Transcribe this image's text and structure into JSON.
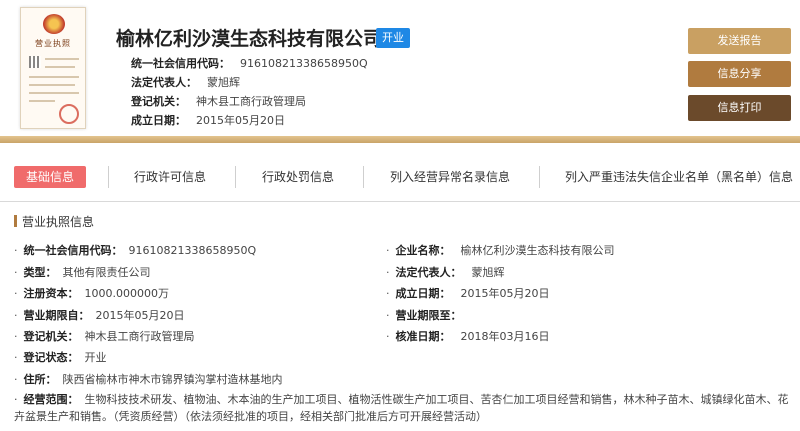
{
  "header": {
    "license_title": "营业执照",
    "company_name": "榆林亿利沙漠生态科技有限公司",
    "status": "开业",
    "credit_code_label": "统一社会信用代码：",
    "credit_code": "91610821338658950Q",
    "legal_rep_label": "法定代表人：",
    "legal_rep": "蒙旭辉",
    "authority_label": "登记机关：",
    "authority": "神木县工商行政管理局",
    "founded_label": "成立日期：",
    "founded": "2015年05月20日"
  },
  "actions": {
    "report": "发送报告",
    "share": "信息分享",
    "print": "信息打印"
  },
  "tabs": [
    {
      "label": "基础信息",
      "active": true
    },
    {
      "label": "行政许可信息",
      "active": false
    },
    {
      "label": "行政处罚信息",
      "active": false
    },
    {
      "label": "列入经营异常名录信息",
      "active": false
    },
    {
      "label": "列入严重违法失信企业名单（黑名单）信息",
      "active": false
    }
  ],
  "section": {
    "title": "营业执照信息"
  },
  "details": {
    "credit_code": {
      "label": "统一社会信用代码：",
      "value": "91610821338658950Q"
    },
    "company_name": {
      "label": "企业名称：",
      "value": "榆林亿利沙漠生态科技有限公司"
    },
    "type": {
      "label": "类型：",
      "value": "其他有限责任公司"
    },
    "legal_rep": {
      "label": "法定代表人：",
      "value": "蒙旭辉"
    },
    "capital": {
      "label": "注册资本：",
      "value": "1000.000000万"
    },
    "founded": {
      "label": "成立日期：",
      "value": "2015年05月20日"
    },
    "term_from": {
      "label": "营业期限自：",
      "value": "2015年05月20日"
    },
    "term_to": {
      "label": "营业期限至：",
      "value": ""
    },
    "authority": {
      "label": "登记机关：",
      "value": "神木县工商行政管理局"
    },
    "approval_date": {
      "label": "核准日期：",
      "value": "2018年03月16日"
    },
    "reg_status": {
      "label": "登记状态：",
      "value": "开业"
    },
    "address": {
      "label": "住所：",
      "value": "陕西省榆林市神木市锦界镇沟掌村造林基地内"
    },
    "scope": {
      "label": "经营范围：",
      "value": "生物科技技术研发、植物油、木本油的生产加工项目、植物活性碳生产加工项目、苦杏仁加工项目经营和销售，林木种子苗木、城镇绿化苗木、花卉盆景生产和销售。（凭资质经营）（依法须经批准的项目，经相关部门批准后方可开展经营活动）"
    }
  },
  "colors": {
    "accent_gold": "#c9a062",
    "accent_brown": "#b07b3f",
    "dark_brown": "#6b4a2b",
    "active_tab": "#f06b6b",
    "status_blue": "#1e88e5"
  }
}
